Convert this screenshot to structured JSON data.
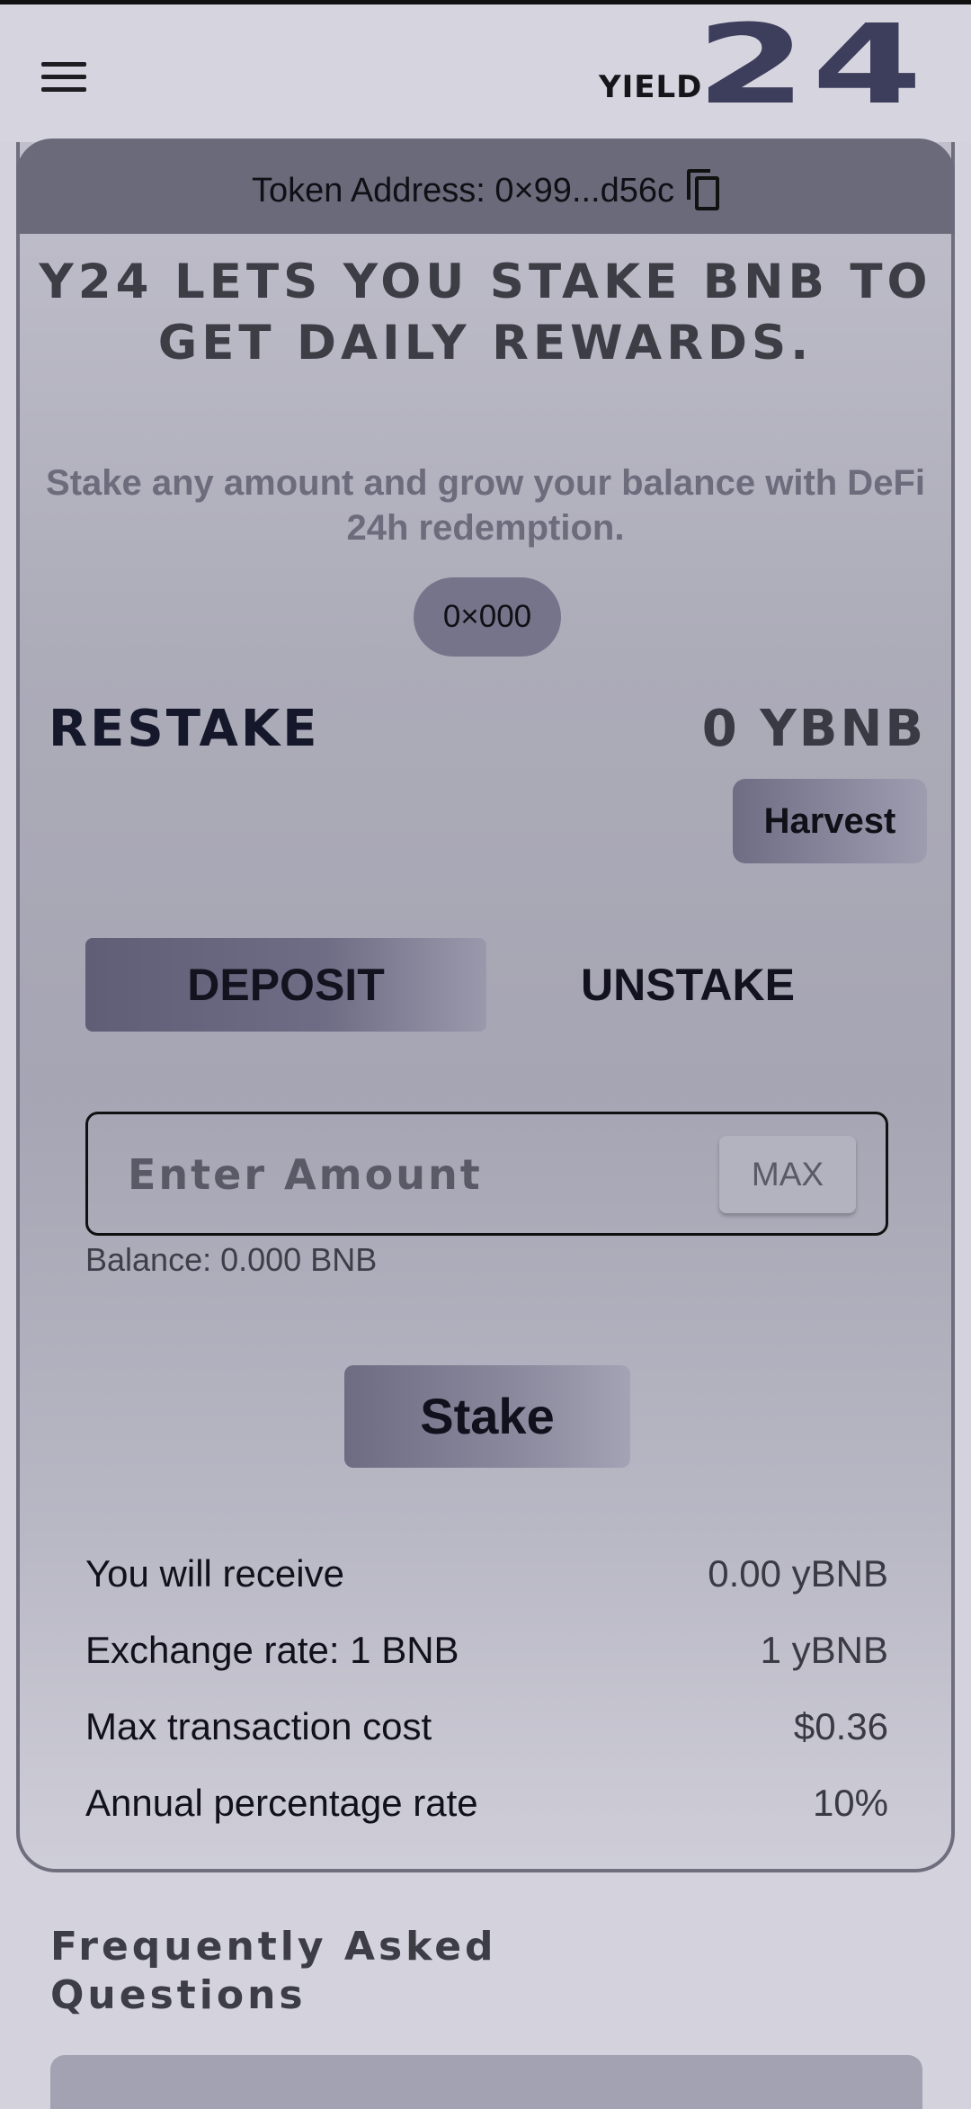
{
  "header": {
    "logo_small": "YIELD",
    "logo_big": "24"
  },
  "token": {
    "label": "Token Address: 0×99...d56c"
  },
  "hero": {
    "title": "Y24 LETS YOU STAKE BNB TO GET DAILY REWARDS.",
    "subtitle": "Stake any amount and grow your balance with DeFi 24h redemption."
  },
  "wallet": {
    "address": "0×000"
  },
  "restake": {
    "label": "RESTAKE",
    "value": "0 YBNB",
    "harvest_label": "Harvest"
  },
  "tabs": {
    "deposit": "DEPOSIT",
    "unstake": "UNSTAKE"
  },
  "amount": {
    "placeholder": "Enter Amount",
    "max_label": "MAX",
    "balance": "Balance: 0.000 BNB"
  },
  "stake_label": "Stake",
  "info": [
    {
      "label": "You will receive",
      "value": "0.00 yBNB"
    },
    {
      "label": "Exchange rate: 1 BNB",
      "value": "1 yBNB"
    },
    {
      "label": "Max transaction cost",
      "value": "$0.36"
    },
    {
      "label": "Annual percentage rate",
      "value": "10%"
    }
  ],
  "faq": {
    "title": "Frequently Asked Questions"
  },
  "colors": {
    "accent": "#5f5e76",
    "background": "#d4d3dd",
    "card_header": "#6b6a7a"
  }
}
